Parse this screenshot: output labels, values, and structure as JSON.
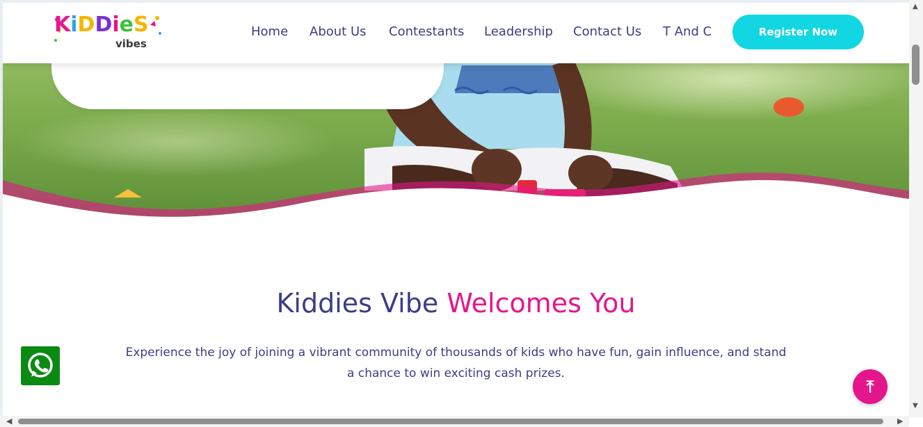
{
  "brand": {
    "logo_main_letters": [
      "K",
      "i",
      "D",
      "D",
      "i",
      "e",
      "S"
    ],
    "logo_sub": "vibes",
    "logo_letter_colors": [
      "#e5168c",
      "#2aa3f0",
      "#f7b500",
      "#7a2fd6",
      "#e5168c",
      "#3fbf3f",
      "#f7b500"
    ]
  },
  "nav": {
    "items": [
      {
        "label": "Home"
      },
      {
        "label": "About Us"
      },
      {
        "label": "Contestants"
      },
      {
        "label": "Leadership"
      },
      {
        "label": "Contact Us"
      },
      {
        "label": "T And C"
      }
    ],
    "register_label": "Register Now"
  },
  "welcome": {
    "title_part1": "Kiddies Vibe",
    "title_part2": "Welcomes You",
    "text": "Experience the joy of joining a vibrant community of thousands of kids who have fun, gain influence, and stand a chance to win exciting cash prizes."
  },
  "icons": {
    "whatsapp": "whatsapp-icon",
    "scroll_top": "arrow-up-icon"
  },
  "colors": {
    "navy": "#3b3d87",
    "pink": "#e5168c",
    "cyan": "#12d6e2",
    "whatsapp_green": "#0b8a12"
  }
}
